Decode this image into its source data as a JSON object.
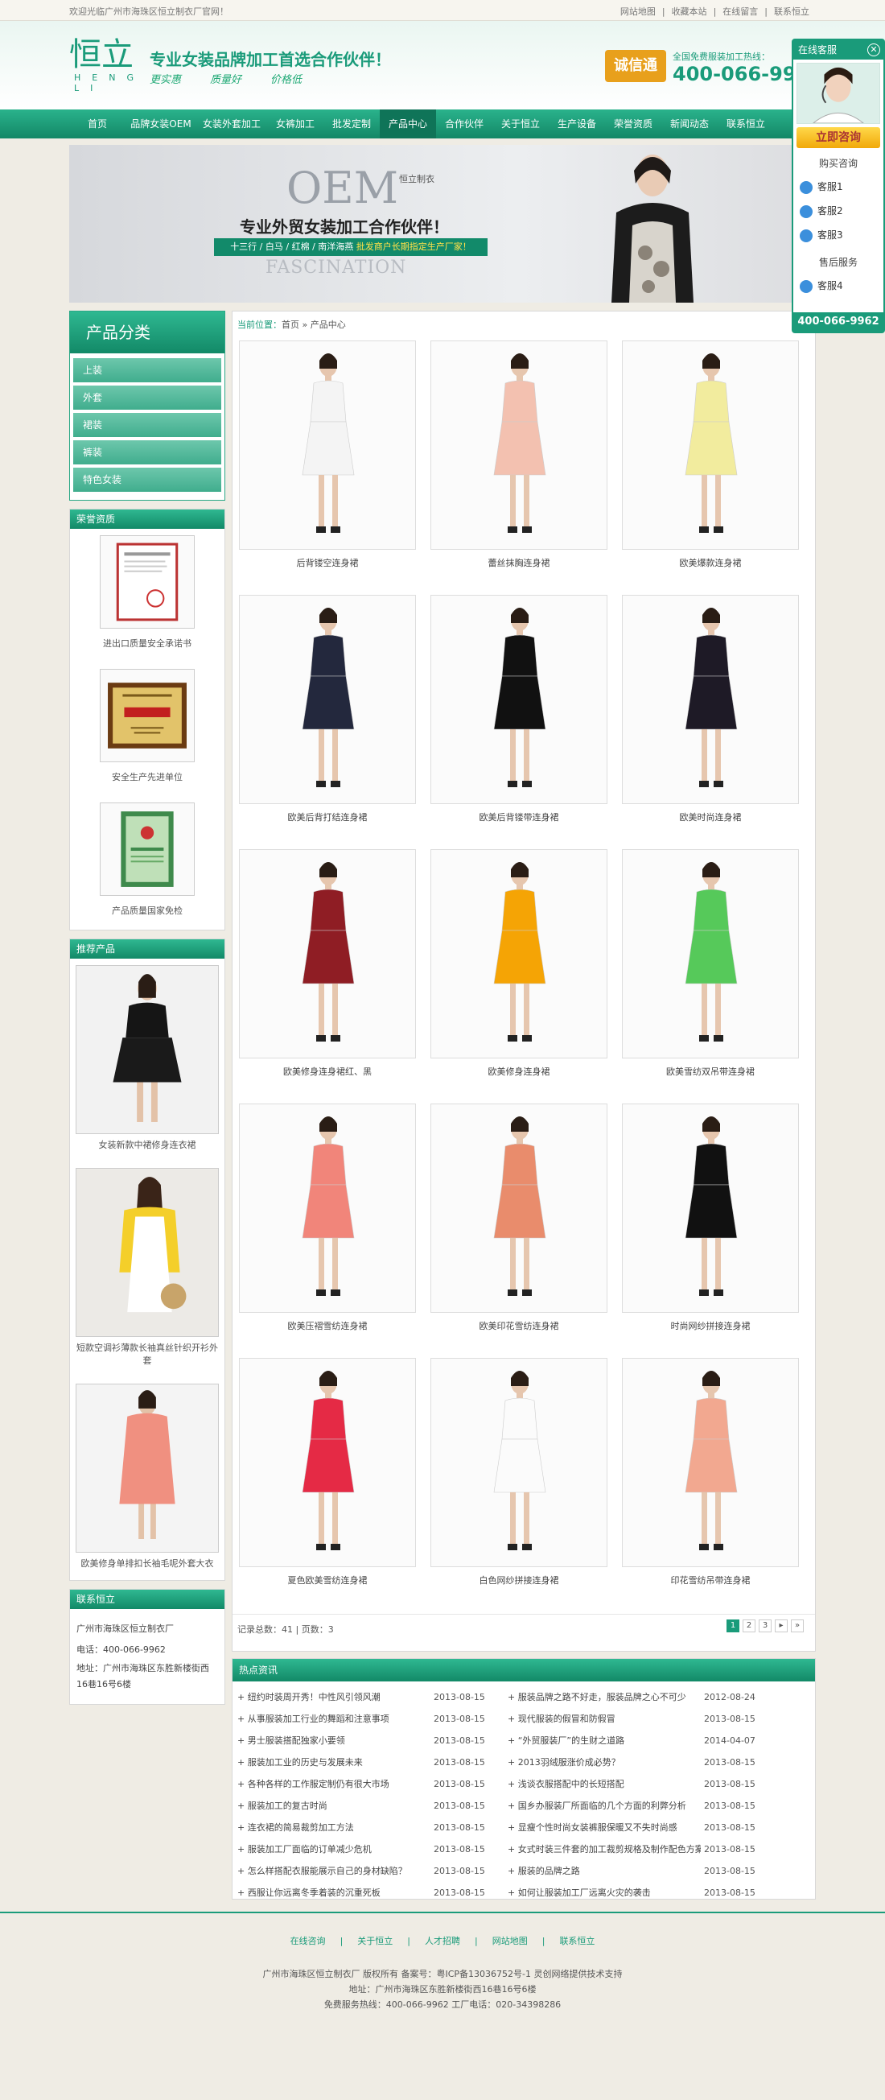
{
  "topbar": {
    "welcome": "欢迎光临广州市海珠区恒立制衣厂官网！",
    "links": [
      "网站地图",
      "|",
      "收藏本站",
      "|",
      "在线留言",
      "|",
      "联系恒立"
    ]
  },
  "header": {
    "logo_cn": "恒立",
    "logo_en": "HENG LI",
    "slogan": "专业女装品牌加工首选合作伙伴！",
    "slogan_sub": [
      "更实惠",
      "质量好",
      "价格低"
    ],
    "badge": "诚信通",
    "hotline_label": "全国免费服装加工热线：",
    "hotline": "400-066-9962"
  },
  "nav": [
    "首页",
    "品牌女装OEM",
    "女装外套加工",
    "女裤加工",
    "批发定制",
    "产品中心",
    "合作伙伴",
    "关于恒立",
    "生产设备",
    "荣誉资质",
    "新闻动态",
    "联系恒立"
  ],
  "banner": {
    "oem": "OEM",
    "tag": "恒立制衣",
    "title": "专业外贸女装加工合作伙伴！",
    "ribbon_a": "十三行 / 白马 / 红棉 / 南洋海燕",
    "ribbon_b": "批发商户长期指定生产厂家！",
    "fascination": "FASCINATION"
  },
  "sidebar": {
    "cat_title": "产品分类",
    "categories": [
      "上装",
      "外套",
      "裙装",
      "裤装",
      "特色女装"
    ],
    "honor_title": "荣誉资质",
    "honors": [
      "进出口质量安全承诺书",
      "安全生产先进单位",
      "产品质量国家免检"
    ],
    "rec_title": "推荐产品",
    "recommended": [
      "女装新款中裙修身连衣裙",
      "短款空调衫薄款长袖真丝针织开衫外套",
      "欧美修身单排扣长袖毛呢外套大衣"
    ],
    "contact_title": "联系恒立",
    "contact_company": "广州市海珠区恒立制衣厂",
    "contact_phone": "电话：400-066-9962",
    "contact_addr": "地址：广州市海珠区东胜新楼街西16巷16号6楼"
  },
  "crumb": {
    "label": "当前位置：",
    "home": "首页",
    "sep": " » ",
    "current": "产品中心"
  },
  "products": [
    {
      "name": "后背镂空连身裙",
      "color": "#f4f4f4"
    },
    {
      "name": "蕾丝抹胸连身裙",
      "color": "#f3c1b0"
    },
    {
      "name": "欧美爆款连身裙",
      "color": "#f2ec9e"
    },
    {
      "name": "欧美后背打结连身裙",
      "color": "#23283d"
    },
    {
      "name": "欧美后背镂带连身裙",
      "color": "#111111"
    },
    {
      "name": "欧美时尚连身裙",
      "color": "#1e1a26"
    },
    {
      "name": "欧美修身连身裙红、黑",
      "color": "#8f1d24"
    },
    {
      "name": "欧美修身连身裙",
      "color": "#f5a405"
    },
    {
      "name": "欧美雪纺双吊带连身裙",
      "color": "#56c95a"
    },
    {
      "name": "欧美压褶雪纺连身裙",
      "color": "#f1857a"
    },
    {
      "name": "欧美印花雪纺连身裙",
      "color": "#e98c6c"
    },
    {
      "name": "时尚网纱拼接连身裙",
      "color": "#111111"
    },
    {
      "name": "夏色欧美雪纺连身裙",
      "color": "#e52a45"
    },
    {
      "name": "白色网纱拼接连身裙",
      "color": "#fbfbfb"
    },
    {
      "name": "印花雪纺吊带连身裙",
      "color": "#f2a890"
    }
  ],
  "pager": {
    "info": "记录总数：41 | 页数：3",
    "pages": [
      "1",
      "2",
      "3",
      "▸",
      "»"
    ]
  },
  "news": {
    "title": "热点资讯",
    "left": [
      {
        "t": "纽约时装周开秀！中性风引领风潮",
        "d": "2013-08-15"
      },
      {
        "t": "从事服装加工行业的舞蹈和注意事项",
        "d": "2013-08-15"
      },
      {
        "t": "男士服装搭配独家小要领",
        "d": "2013-08-15"
      },
      {
        "t": "服装加工业的历史与发展未来",
        "d": "2013-08-15"
      },
      {
        "t": "各种各样的工作服定制仍有很大市场",
        "d": "2013-08-15"
      },
      {
        "t": "服装加工的复古时尚",
        "d": "2013-08-15"
      },
      {
        "t": "连衣裙的简易裁剪加工方法",
        "d": "2013-08-15"
      },
      {
        "t": "服装加工厂面临的订单减少危机",
        "d": "2013-08-15"
      },
      {
        "t": "怎么样搭配衣服能展示自己的身材缺陷？",
        "d": "2013-08-15"
      },
      {
        "t": "西服让你远离冬季着装的沉重死板",
        "d": "2013-08-15"
      }
    ],
    "right": [
      {
        "t": "服装品牌之路不好走，服装品牌之心不可少",
        "d": "2012-08-24"
      },
      {
        "t": "现代服装的假冒和防假冒",
        "d": "2013-08-15"
      },
      {
        "t": "“外贸服装厂”的生财之道路",
        "d": "2014-04-07"
      },
      {
        "t": "2013羽绒服涨价成必势？",
        "d": "2013-08-15"
      },
      {
        "t": "浅谈衣服搭配中的长短搭配",
        "d": "2013-08-15"
      },
      {
        "t": "国乡办服装厂所面临的几个方面的利弊分析",
        "d": "2013-08-15"
      },
      {
        "t": "显瘦个性时尚女装裤服保暖又不失时尚感",
        "d": "2013-08-15"
      },
      {
        "t": "女式时装三件套的加工裁剪规格及制作配色方案",
        "d": "2013-08-15"
      },
      {
        "t": "服装的品牌之路",
        "d": "2013-08-15"
      },
      {
        "t": "如何让服装加工厂远离火灾的袭击",
        "d": "2013-08-15"
      }
    ]
  },
  "footer": {
    "links": [
      "在线咨询",
      "|",
      "关于恒立",
      "|",
      "人才招聘",
      "|",
      "网站地图",
      "|",
      "联系恒立"
    ],
    "line1": "广州市海珠区恒立制衣厂 版权所有 备案号：粤ICP备13036752号-1 灵创网络提供技术支持",
    "line2": "地址：广州市海珠区东胜新楼街西16巷16号6楼",
    "line3": "免费服务热线：400-066-9962 工厂电话：020-34398286"
  },
  "kefu": {
    "title": "在线客服",
    "consult": "立即咨询",
    "buy": "购买咨询",
    "buy_list": [
      "客服1",
      "客服2",
      "客服3"
    ],
    "after": "售后服务",
    "after_list": [
      "客服4"
    ],
    "tel": "400-066-9962"
  }
}
